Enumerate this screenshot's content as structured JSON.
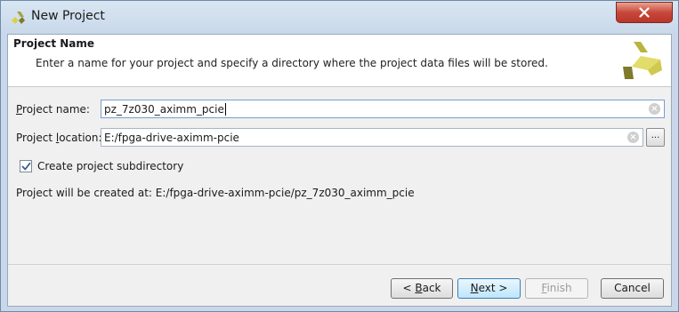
{
  "window": {
    "title": "New Project",
    "close_icon": "close-icon"
  },
  "header": {
    "title": "Project Name",
    "description": "Enter a name for your project and specify a directory where the project data files will be stored."
  },
  "form": {
    "project_name": {
      "label_prefix": "",
      "label_mnemonic": "P",
      "label_rest": "roject name:",
      "value": "pz_7z030_aximm_pcie"
    },
    "project_location": {
      "label_prefix": "Project ",
      "label_mnemonic": "l",
      "label_rest": "ocation:",
      "value": "E:/fpga-drive-aximm-pcie",
      "browse_label": "..."
    },
    "create_subdirectory": {
      "label": "Create project subdirectory",
      "checked": true
    },
    "created_at": {
      "label": "Project will be created at:",
      "path": "E:/fpga-drive-aximm-pcie/pz_7z030_aximm_pcie"
    }
  },
  "footer": {
    "back": {
      "prefix": "< ",
      "mnemonic": "B",
      "rest": "ack"
    },
    "next": {
      "mnemonic": "N",
      "rest": "ext >"
    },
    "finish": {
      "mnemonic": "F",
      "rest": "inish"
    },
    "cancel": {
      "label": "Cancel"
    }
  },
  "colors": {
    "title_bar": "#c9d9ea",
    "close_button": "#c8473a",
    "logo_yellow": "#d8d24a",
    "logo_olive": "#7f7a2c",
    "primary_button": "#bee6fd"
  }
}
